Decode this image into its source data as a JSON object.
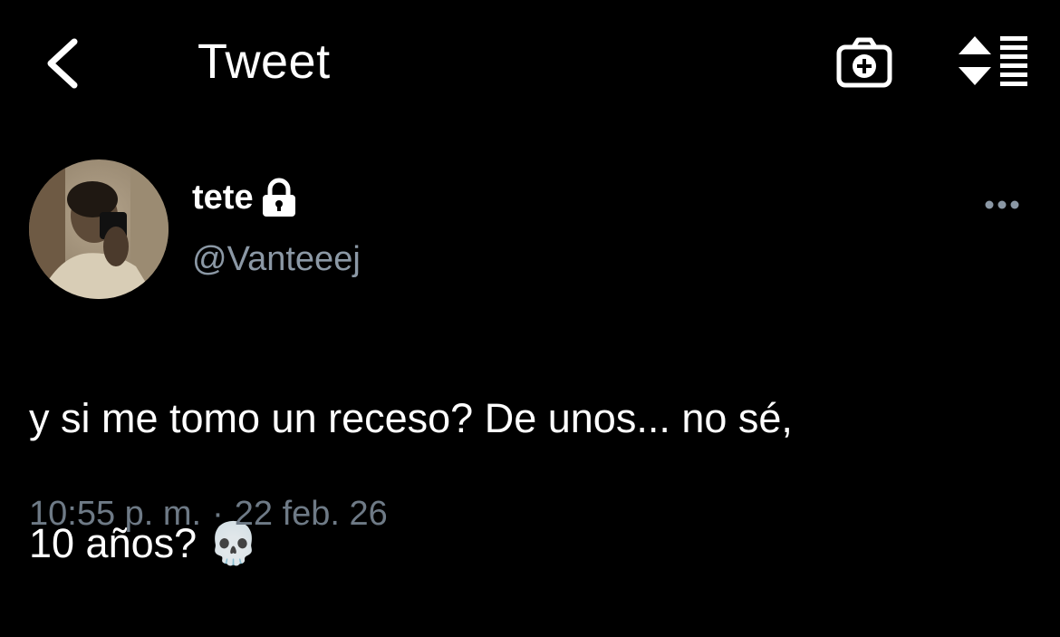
{
  "nav": {
    "title": "Tweet",
    "back_icon": "chevron-left-icon",
    "camera_icon": "camera-plus-icon",
    "sort_icon": "sort-list-icon"
  },
  "tweet": {
    "display_name": "tete",
    "protected_icon": "lock-icon",
    "handle": "@Vanteeej",
    "more_icon": "more-horizontal-icon",
    "text_line1": "y si me tomo un receso? De unos... no sé,",
    "text_line2": "10 años? 💀",
    "time": "10:55 p. m.",
    "separator": "·",
    "date": "22 feb. 26"
  },
  "colors": {
    "background": "#000000",
    "primary_text": "#ffffff",
    "secondary_text": "#8b98a5",
    "timestamp_text": "#6e7a86"
  }
}
